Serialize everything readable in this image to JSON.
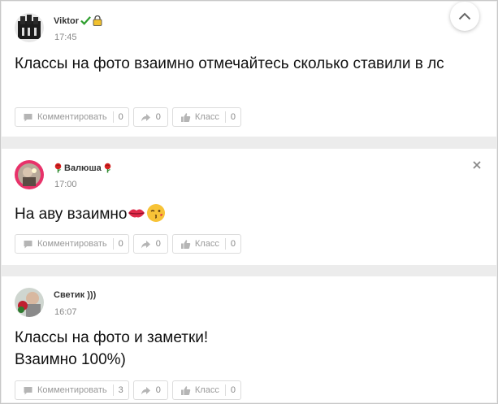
{
  "feed": {
    "items": [
      {
        "author": "Viktor",
        "time": "17:45",
        "text": "Классы на фото взаимно отмечайтесь сколько ставили в лс",
        "actions": {
          "comment_label": "Комментировать",
          "comment_count": "0",
          "share_count": "0",
          "like_label": "Класс",
          "like_count": "0"
        }
      },
      {
        "author": "Валюша",
        "time": "17:00",
        "text": "На аву взаимно",
        "actions": {
          "comment_label": "Комментировать",
          "comment_count": "0",
          "share_count": "0",
          "like_label": "Класс",
          "like_count": "0"
        }
      },
      {
        "author": "Светик )))",
        "time": "16:07",
        "text_line1": "Классы на фото и заметки!",
        "text_line2": "Взаимно 100%)",
        "actions": {
          "comment_label": "Комментировать",
          "comment_count": "3",
          "share_count": "0",
          "like_label": "Класс",
          "like_count": "0"
        }
      }
    ]
  },
  "icons": {
    "scroll_up": "chevron-up-icon",
    "close": "close-icon",
    "comment": "comment-bubble-icon",
    "share": "share-arrow-icon",
    "like": "thumbs-up-icon",
    "verified": "checkmark-icon",
    "lock": "lock-icon",
    "rose": "rose-icon",
    "kiss": "kiss-lips-icon",
    "face": "kissing-face-icon"
  },
  "colors": {
    "accent_green": "#2e9e2e",
    "lock_yellow": "#f2c12e",
    "rose_red": "#d42020",
    "muted_text": "#999999"
  }
}
